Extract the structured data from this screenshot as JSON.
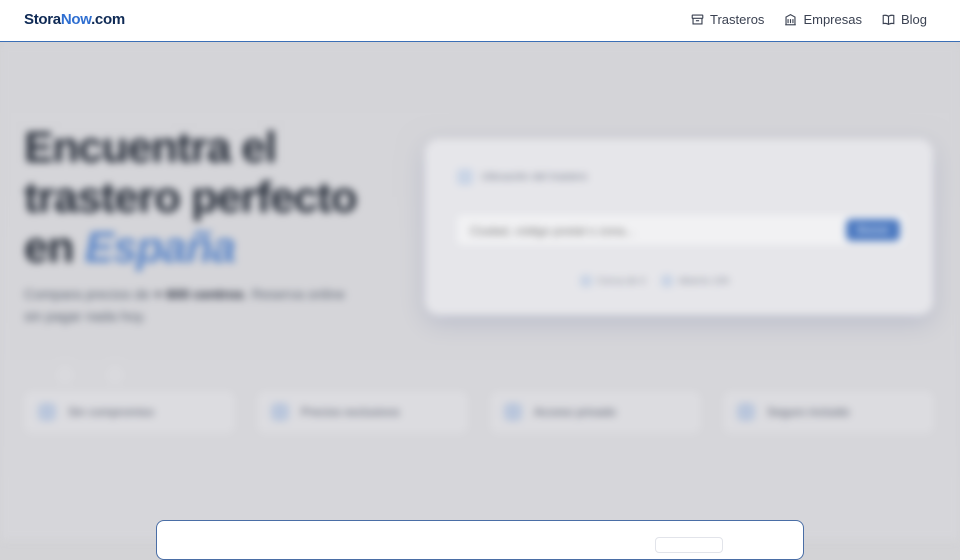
{
  "header": {
    "logo": {
      "part1": "Stora",
      "part2": "Now",
      "part3": ".com"
    },
    "nav": [
      {
        "label": "Trasteros",
        "icon": "storage-box-icon"
      },
      {
        "label": "Empresas",
        "icon": "building-icon"
      },
      {
        "label": "Blog",
        "icon": "book-open-icon"
      }
    ]
  },
  "hero": {
    "title_line1": "Encuentra el",
    "title_line2": "trastero perfecto",
    "title_line3_prefix": "en ",
    "title_line3_highlight": "España",
    "subtitle_pre": "Compara precios de ",
    "subtitle_bold": "+ 600 centros",
    "subtitle_post": ". Reserva online sin pagar nada hoy."
  },
  "search": {
    "heading": "Ubicación del trastero",
    "placeholder": "Ciudad, código postal o zona...",
    "button_label": "Buscar",
    "links": [
      "Cerca de ti",
      "Abierto 24h"
    ]
  },
  "features": [
    {
      "label": "Sin compromiso",
      "icon": "check-shield-icon"
    },
    {
      "label": "Precios exclusivos",
      "icon": "tag-icon"
    },
    {
      "label": "Acceso privado",
      "icon": "lock-icon"
    },
    {
      "label": "Seguro incluido",
      "icon": "shield-icon"
    }
  ],
  "colors": {
    "brand_dark": "#0f2a55",
    "brand_accent": "#2f6fd1",
    "header_border": "#3b6fb6"
  }
}
